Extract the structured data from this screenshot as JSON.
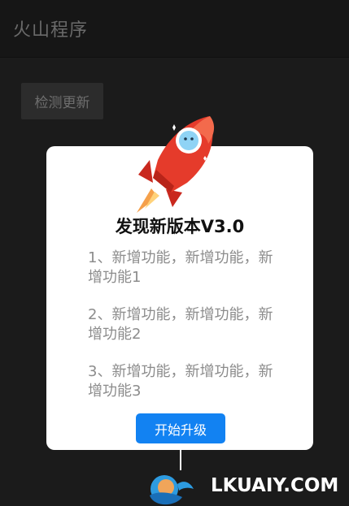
{
  "appbar": {
    "title": "火山程序"
  },
  "main": {
    "check_button": "检测更新"
  },
  "dialog": {
    "title": "发现新版本V3.0",
    "notes": [
      "1、新增功能，新增功能，新增功能1",
      "2、新增功能，新增功能，新增功能2",
      "3、新增功能，新增功能，新增功能3"
    ],
    "upgrade_button": "开始升级"
  },
  "watermark": {
    "text": "LKUAIY.COM"
  },
  "colors": {
    "accent": "#1282f2",
    "rocket_red": "#e53b2b",
    "background": "#1b1b1b"
  }
}
